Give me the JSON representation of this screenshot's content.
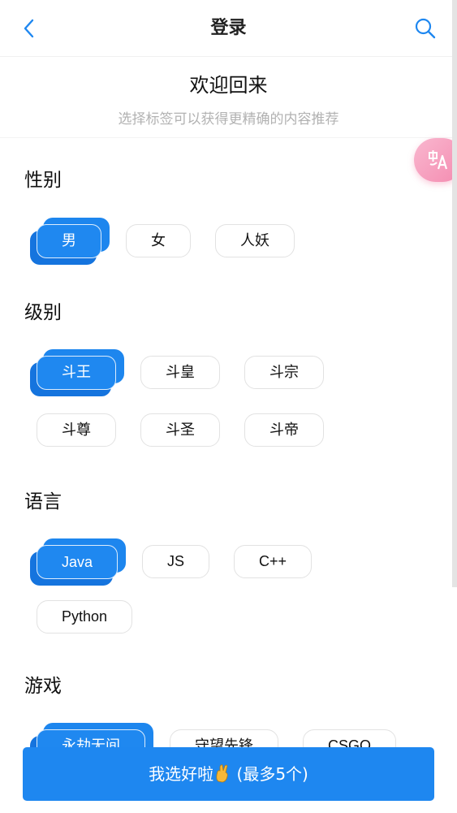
{
  "header": {
    "title": "登录"
  },
  "welcome": {
    "title": "欢迎回来",
    "subtitle": "选择标签可以获得更精确的内容推荐"
  },
  "sections": {
    "gender": {
      "title": "性别",
      "tags": [
        "男",
        "女",
        "人妖"
      ],
      "selected": "男"
    },
    "level": {
      "title": "级别",
      "tags": [
        "斗王",
        "斗皇",
        "斗宗",
        "斗尊",
        "斗圣",
        "斗帝"
      ],
      "selected": "斗王"
    },
    "language": {
      "title": "语言",
      "tags": [
        "Java",
        "JS",
        "C++",
        "Python"
      ],
      "selected": "Java"
    },
    "game": {
      "title": "游戏",
      "tags": [
        "永劫无间",
        "守望先锋",
        "CSGO"
      ],
      "selected": "永劫无间"
    }
  },
  "confirm_button": {
    "label_before": "我选好啦",
    "emoji": "crossed-fingers-icon",
    "label_after": " (最多5个)"
  },
  "colors": {
    "accent": "#1e87f0",
    "translate_fab": "#f48bb0"
  }
}
